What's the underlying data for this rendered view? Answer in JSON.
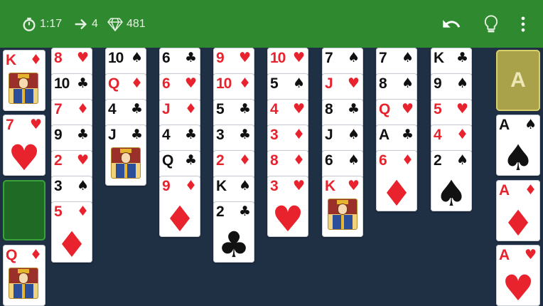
{
  "header": {
    "timer": "1:17",
    "moves": "4",
    "score": "481",
    "icons": [
      "stopwatch-icon",
      "arrow-right-icon",
      "diamond-gem-icon",
      "undo-icon",
      "lightbulb-icon",
      "more-vert-icon"
    ]
  },
  "colors": {
    "bar": "#2f8a2f",
    "table": "#1f2f44",
    "red": "#e8232e",
    "black": "#111111",
    "free_cell": "#1f6a25",
    "foundation_empty": "#a9a24a"
  },
  "left_cells": [
    {
      "rank": "K",
      "suit": "♦",
      "color": "red",
      "face": true
    },
    {
      "rank": "7",
      "suit": "♥",
      "color": "red"
    },
    {
      "rank": "",
      "suit": "",
      "color": "",
      "empty": true
    },
    {
      "rank": "Q",
      "suit": "♦",
      "color": "red",
      "face": true
    }
  ],
  "foundations": [
    {
      "label": "A",
      "empty": true
    },
    {
      "rank": "A",
      "suit": "♠",
      "color": "black"
    },
    {
      "rank": "A",
      "suit": "♦",
      "color": "red"
    },
    {
      "rank": "A",
      "suit": "♥",
      "color": "red"
    }
  ],
  "columns": [
    [
      {
        "rank": "8",
        "suit": "♥",
        "color": "red"
      },
      {
        "rank": "10",
        "suit": "♣",
        "color": "black"
      },
      {
        "rank": "7",
        "suit": "♦",
        "color": "red"
      },
      {
        "rank": "9",
        "suit": "♣",
        "color": "black"
      },
      {
        "rank": "2",
        "suit": "♥",
        "color": "red"
      },
      {
        "rank": "3",
        "suit": "♠",
        "color": "black"
      },
      {
        "rank": "5",
        "suit": "♦",
        "color": "red"
      }
    ],
    [
      {
        "rank": "10",
        "suit": "♠",
        "color": "black"
      },
      {
        "rank": "Q",
        "suit": "♦",
        "color": "red"
      },
      {
        "rank": "4",
        "suit": "♣",
        "color": "black"
      },
      {
        "rank": "J",
        "suit": "♣",
        "color": "black",
        "face": true
      }
    ],
    [
      {
        "rank": "6",
        "suit": "♣",
        "color": "black"
      },
      {
        "rank": "6",
        "suit": "♥",
        "color": "red"
      },
      {
        "rank": "J",
        "suit": "♦",
        "color": "red"
      },
      {
        "rank": "4",
        "suit": "♣",
        "color": "black"
      },
      {
        "rank": "Q",
        "suit": "♣",
        "color": "black"
      },
      {
        "rank": "9",
        "suit": "♦",
        "color": "red"
      }
    ],
    [
      {
        "rank": "9",
        "suit": "♥",
        "color": "red"
      },
      {
        "rank": "10",
        "suit": "♦",
        "color": "red"
      },
      {
        "rank": "5",
        "suit": "♣",
        "color": "black"
      },
      {
        "rank": "3",
        "suit": "♣",
        "color": "black"
      },
      {
        "rank": "2",
        "suit": "♦",
        "color": "red"
      },
      {
        "rank": "K",
        "suit": "♠",
        "color": "black"
      },
      {
        "rank": "2",
        "suit": "♣",
        "color": "black"
      }
    ],
    [
      {
        "rank": "10",
        "suit": "♥",
        "color": "red"
      },
      {
        "rank": "5",
        "suit": "♠",
        "color": "black"
      },
      {
        "rank": "4",
        "suit": "♥",
        "color": "red"
      },
      {
        "rank": "3",
        "suit": "♦",
        "color": "red"
      },
      {
        "rank": "8",
        "suit": "♦",
        "color": "red"
      },
      {
        "rank": "3",
        "suit": "♥",
        "color": "red"
      }
    ],
    [
      {
        "rank": "7",
        "suit": "♠",
        "color": "black"
      },
      {
        "rank": "J",
        "suit": "♥",
        "color": "red"
      },
      {
        "rank": "8",
        "suit": "♣",
        "color": "black"
      },
      {
        "rank": "J",
        "suit": "♠",
        "color": "black"
      },
      {
        "rank": "6",
        "suit": "♠",
        "color": "black"
      },
      {
        "rank": "K",
        "suit": "♥",
        "color": "red",
        "face": true
      }
    ],
    [
      {
        "rank": "7",
        "suit": "♠",
        "color": "black"
      },
      {
        "rank": "8",
        "suit": "♠",
        "color": "black"
      },
      {
        "rank": "Q",
        "suit": "♥",
        "color": "red"
      },
      {
        "rank": "A",
        "suit": "♣",
        "color": "black"
      },
      {
        "rank": "6",
        "suit": "♦",
        "color": "red"
      }
    ],
    [
      {
        "rank": "K",
        "suit": "♣",
        "color": "black"
      },
      {
        "rank": "9",
        "suit": "♠",
        "color": "black"
      },
      {
        "rank": "5",
        "suit": "♥",
        "color": "red"
      },
      {
        "rank": "4",
        "suit": "♦",
        "color": "red"
      },
      {
        "rank": "2",
        "suit": "♠",
        "color": "black"
      }
    ]
  ]
}
